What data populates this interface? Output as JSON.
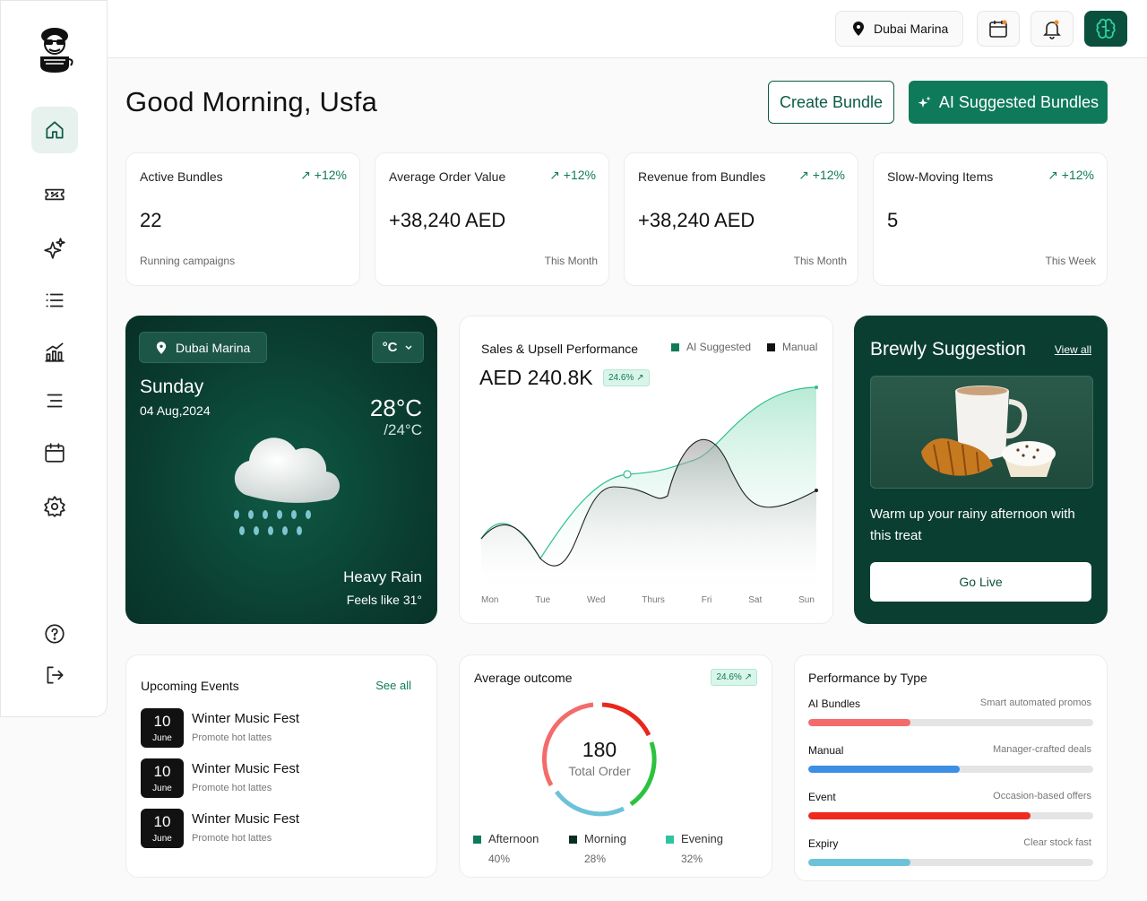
{
  "topbar": {
    "location": "Dubai Marina"
  },
  "greeting": "Good Morning, Usfa",
  "actions": {
    "create": "Create Bundle",
    "ai": "AI Suggested Bundles"
  },
  "stats": [
    {
      "title": "Active Bundles",
      "change": "+12%",
      "value": "22",
      "footer": "Running campaigns"
    },
    {
      "title": "Average Order Value",
      "change": "+12%",
      "value": "+38,240 AED",
      "footer": "This Month"
    },
    {
      "title": "Revenue from Bundles",
      "change": "+12%",
      "value": "+38,240 AED",
      "footer": "This Month"
    },
    {
      "title": "Slow-Moving Items",
      "change": "+12%",
      "value": "5",
      "footer": "This Week"
    }
  ],
  "weather": {
    "location": "Dubai Marina",
    "unit": "°C",
    "day": "Sunday",
    "date": "04 Aug,2024",
    "temp": "28°C",
    "low": "/24°C",
    "condition": "Heavy Rain",
    "feels": "Feels like 31°"
  },
  "sales": {
    "title": "Sales & Upsell Performance",
    "legend_ai": "AI Suggested",
    "legend_manual": "Manual",
    "value": "AED 240.8K",
    "badge": "24.6%",
    "days": [
      "Mon",
      "Tue",
      "Wed",
      "Thurs",
      "Fri",
      "Sat",
      "Sun"
    ]
  },
  "suggestion": {
    "title": "Brewly Suggestion",
    "view_all": "View all",
    "text": "Warm up your rainy afternoon with this treat",
    "cta": "Go Live"
  },
  "events": {
    "title": "Upcoming Events",
    "see_all": "See all",
    "items": [
      {
        "day": "10",
        "month": "June",
        "name": "Winter Music Fest",
        "desc": "Promote hot lattes"
      },
      {
        "day": "10",
        "month": "June",
        "name": "Winter Music Fest",
        "desc": "Promote hot lattes"
      },
      {
        "day": "10",
        "month": "June",
        "name": "Winter Music Fest",
        "desc": "Promote hot lattes"
      }
    ]
  },
  "outcome": {
    "title": "Average outcome",
    "badge": "24.6%",
    "total": "180",
    "total_label": "Total Order",
    "legend": [
      {
        "name": "Afternoon",
        "pct": "40%",
        "color": "#0f7a5a"
      },
      {
        "name": "Morning",
        "pct": "28%",
        "color": "#0a2e24"
      },
      {
        "name": "Evening",
        "pct": "32%",
        "color": "#2ec4a0"
      }
    ]
  },
  "performance": {
    "title": "Performance by Type",
    "rows": [
      {
        "name": "AI Bundles",
        "desc": "Smart automated promos",
        "fill": 0.36,
        "color": "#f46b6b"
      },
      {
        "name": "Manual",
        "desc": "Manager-crafted deals",
        "fill": 0.53,
        "color": "#3b8fe4"
      },
      {
        "name": "Event",
        "desc": "Occasion-based offers",
        "fill": 0.78,
        "color": "#f02a1f"
      },
      {
        "name": "Expiry",
        "desc": "Clear stock fast",
        "fill": 0.36,
        "color": "#6cc3d9"
      }
    ]
  }
}
